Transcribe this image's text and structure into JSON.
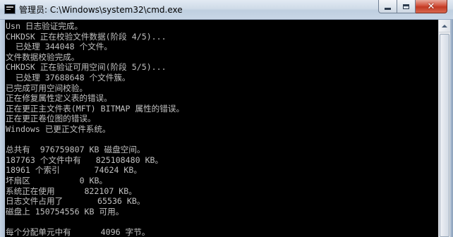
{
  "window": {
    "title": "管理员: C:\\Windows\\system32\\cmd.exe",
    "icon": "cmd-console-icon",
    "buttons": {
      "minimize_icon": "minimize-icon",
      "maximize_icon": "maximize-icon",
      "close_glyph": "✕"
    }
  },
  "console": {
    "text_color": "#c0c0c0",
    "background": "#000000",
    "lines": [
      "Usn 日志验证完成。",
      "CHKDSK 正在校验文件数据(阶段 4/5)...",
      "  已处理 344048 个文件。",
      "文件数据校验完成。",
      "CHKDSK 正在验证可用空间(阶段 5/5)...",
      "  已处理 37688648 个文件簇。",
      "已完成可用空间校验。",
      "正在修复属性定义表的错误。",
      "正在更正主文件表(MFT) BITMAP 属性的错误。",
      "正在更正卷位图的错误。",
      "Windows 已更正文件系统。",
      "",
      "总共有  976759807 KB 磁盘空间。",
      "187763 个文件中有   825108480 KB。",
      "18961 个索引       74624 KB。",
      "坏扇区          0 KB。",
      "系统正在使用      822107 KB。",
      "日志文件占用了       65536 KB。",
      "磁盘上 150754556 KB 可用。",
      "",
      "每个分配单元中有      4096 字节。"
    ]
  }
}
